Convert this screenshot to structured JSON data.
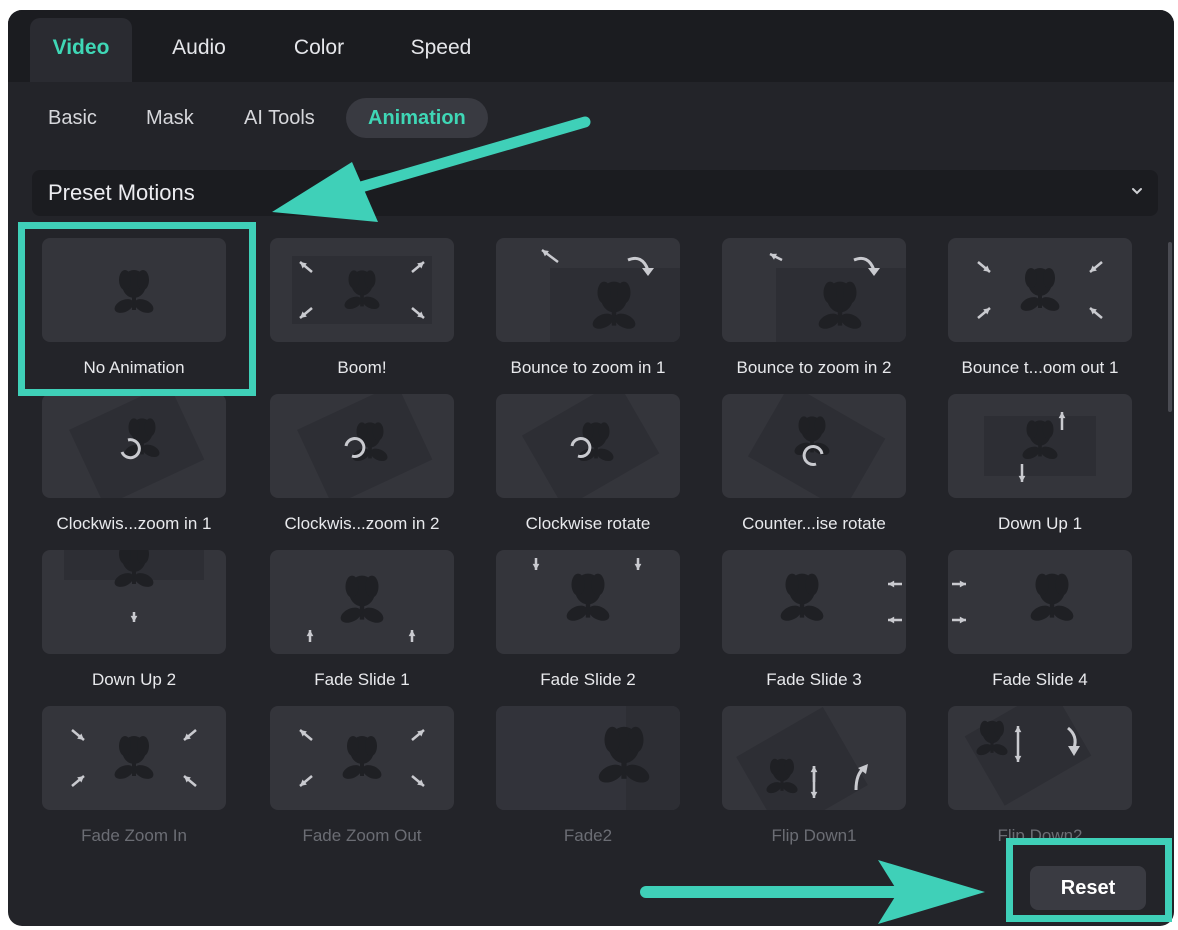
{
  "tabs": [
    {
      "label": "Video",
      "active": true
    },
    {
      "label": "Audio",
      "active": false
    },
    {
      "label": "Color",
      "active": false
    },
    {
      "label": "Speed",
      "active": false
    }
  ],
  "subtabs": [
    {
      "label": "Basic",
      "active": false
    },
    {
      "label": "Mask",
      "active": false
    },
    {
      "label": "AI Tools",
      "active": false
    },
    {
      "label": "Animation",
      "active": true
    }
  ],
  "dropdown": {
    "label": "Preset Motions",
    "icon": "chevron-down-icon"
  },
  "presets": [
    {
      "label": "No Animation",
      "icon": "no-animation-icon"
    },
    {
      "label": "Boom!",
      "icon": "boom-icon"
    },
    {
      "label": "Bounce to zoom in 1",
      "icon": "bounce-zoom-in-icon"
    },
    {
      "label": "Bounce to zoom in 2",
      "icon": "bounce-zoom-in-icon"
    },
    {
      "label": "Bounce t...oom out 1",
      "icon": "bounce-zoom-out-icon"
    },
    {
      "label": "Clockwis...zoom in 1",
      "icon": "rotate-icon"
    },
    {
      "label": "Clockwis...zoom in 2",
      "icon": "rotate-icon"
    },
    {
      "label": "Clockwise rotate",
      "icon": "rotate-icon"
    },
    {
      "label": "Counter...ise rotate",
      "icon": "counter-rotate-icon"
    },
    {
      "label": "Down Up 1",
      "icon": "down-up-icon"
    },
    {
      "label": "Down Up 2",
      "icon": "down-up-icon"
    },
    {
      "label": "Fade Slide 1",
      "icon": "fade-slide-icon"
    },
    {
      "label": "Fade Slide 2",
      "icon": "fade-slide-icon"
    },
    {
      "label": "Fade Slide 3",
      "icon": "fade-slide-icon"
    },
    {
      "label": "Fade Slide 4",
      "icon": "fade-slide-icon"
    },
    {
      "label": "Fade Zoom In",
      "icon": "fade-zoom-in-icon"
    },
    {
      "label": "Fade Zoom Out",
      "icon": "fade-zoom-out-icon"
    },
    {
      "label": "Fade2",
      "icon": "fade-icon"
    },
    {
      "label": "Flip Down1",
      "icon": "flip-down-icon"
    },
    {
      "label": "Flip Down2",
      "icon": "flip-down-icon"
    }
  ],
  "footer": {
    "reset_label": "Reset"
  },
  "colors": {
    "accent": "#3fd7b6",
    "highlight": "#3fd0b8",
    "panel_bg": "#232429",
    "thumb_bg": "#34353b"
  }
}
